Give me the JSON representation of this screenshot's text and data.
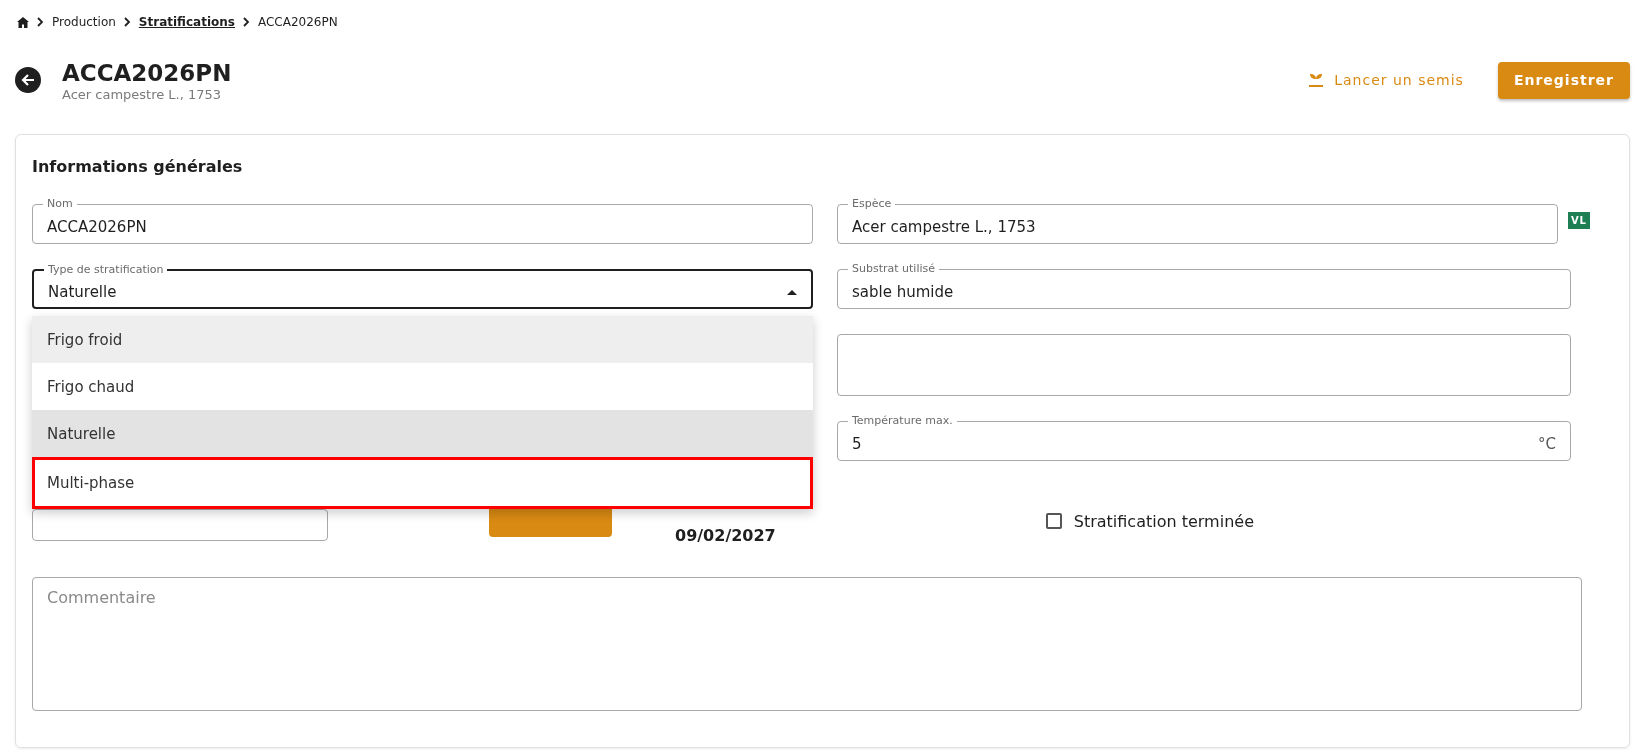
{
  "breadcrumb": [
    {
      "label": "Production",
      "kind": "text"
    },
    {
      "label": "Stratifications",
      "kind": "link"
    },
    {
      "label": "ACCA2026PN",
      "kind": "current"
    }
  ],
  "header": {
    "title": "ACCA2026PN",
    "subtitle": "Acer campestre L., 1753",
    "actions": [
      {
        "label": "Lancer un semis",
        "kind": "text"
      },
      {
        "label": "Enregistrer",
        "kind": "primary"
      }
    ]
  },
  "section": {
    "title": "Informations générales"
  },
  "nom": {
    "label": "Nom",
    "value": "ACCA2026PN"
  },
  "espece": {
    "label": "Espèce",
    "value": "Acer campestre L., 1753",
    "badge": "VL"
  },
  "type_stratification": {
    "label": "Type de stratification",
    "value": "Naturelle",
    "expanded": true,
    "options": [
      {
        "label": "Frigo froid",
        "selected": false,
        "hovered": true,
        "highlighted": false
      },
      {
        "label": "Frigo chaud",
        "selected": false,
        "hovered": false,
        "highlighted": false
      },
      {
        "label": "Naturelle",
        "selected": true,
        "hovered": false,
        "highlighted": false
      },
      {
        "label": "Multi-phase",
        "selected": false,
        "hovered": false,
        "highlighted": true
      }
    ]
  },
  "substrat": {
    "label": "Substrat utilisé",
    "value": "sable humide"
  },
  "temperature_max": {
    "label": "Température max.",
    "value": "5",
    "unit": "°C"
  },
  "date_fin": {
    "value": "09/02/2027"
  },
  "stratification_terminee": {
    "label": "Stratification terminée",
    "checked": false
  },
  "commentaire": {
    "placeholder": "Commentaire"
  }
}
